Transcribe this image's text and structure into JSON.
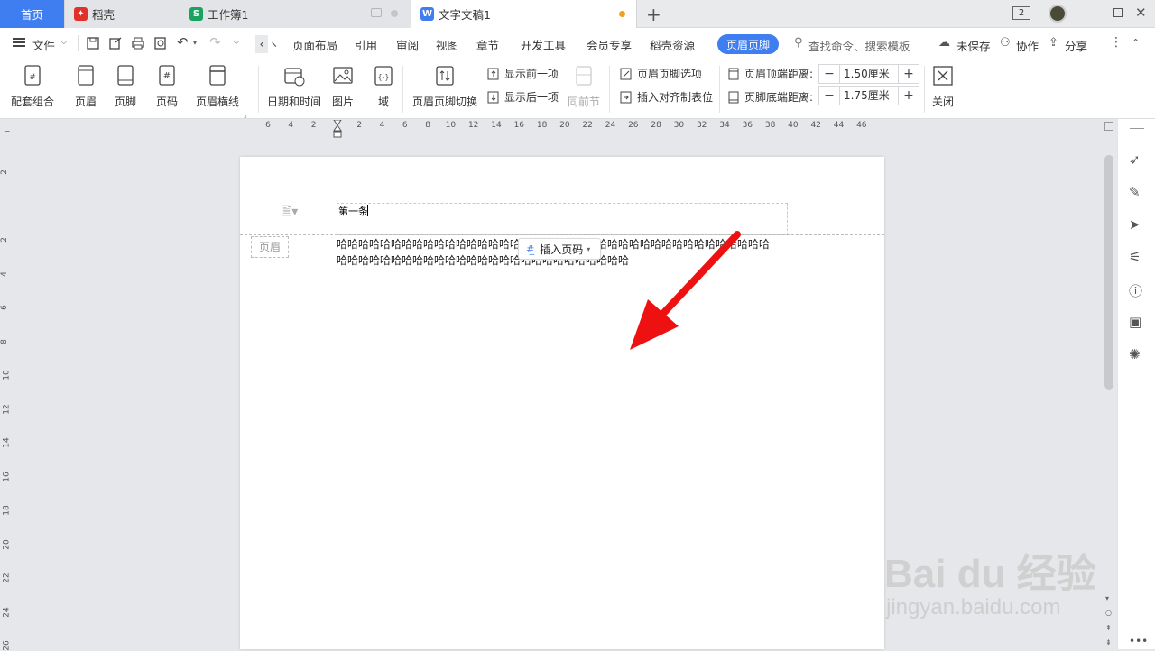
{
  "tabs": [
    {
      "label": "首页"
    },
    {
      "label": "稻壳"
    },
    {
      "label": "工作簿1"
    },
    {
      "label": "文字文稿1"
    }
  ],
  "window_badge": "2",
  "menu": {
    "file": "文件",
    "items": [
      "页面布局",
      "引用",
      "审阅",
      "视图",
      "章节",
      "开发工具",
      "会员专享",
      "稻壳资源"
    ],
    "active": "页眉页脚",
    "search": "查找命令、搜索模板",
    "unsaved": "未保存",
    "collab": "协作",
    "share": "分享"
  },
  "ribbon": {
    "set": "配套组合",
    "header": "页眉",
    "footer": "页脚",
    "pagenum": "页码",
    "headerline": "页眉横线",
    "datetime": "日期和时间",
    "picture": "图片",
    "field": "域",
    "switch": "页眉页脚切换",
    "showprev": "显示前一项",
    "shownext": "显示后一项",
    "samesection": "同前节",
    "options": "页眉页脚选项",
    "inserttab": "插入对齐制表位",
    "topdist_label": "页眉顶端距离:",
    "topdist_val": "1.50厘米",
    "botdist_label": "页脚底端距离:",
    "botdist_val": "1.75厘米",
    "close": "关闭"
  },
  "ruler_h": [
    "6",
    "4",
    "2",
    "",
    "2",
    "4",
    "6",
    "8",
    "10",
    "12",
    "14",
    "16",
    "18",
    "20",
    "22",
    "24",
    "26",
    "28",
    "30",
    "32",
    "34",
    "36",
    "38",
    "40",
    "42",
    "44",
    "46"
  ],
  "ruler_v": [
    "2",
    "",
    "2",
    "4",
    "6",
    "8",
    "10",
    "12",
    "14",
    "16",
    "18",
    "20",
    "22",
    "24",
    "26"
  ],
  "doc": {
    "header_text": "第一条",
    "header_tag": "页眉",
    "insert_pagenum": "插入页码",
    "body_line1": "哈哈哈哈哈哈哈哈哈哈哈哈哈哈哈哈哈哈哈哈哈哈哈哈哈哈哈哈哈哈哈哈哈哈哈哈哈哈哈哈",
    "body_line2": "哈哈哈哈哈哈哈哈哈哈哈哈哈哈哈哈哈哈哈哈哈哈哈哈哈哈哈"
  },
  "watermark": {
    "text": "Bai du 经验",
    "url": "jingyan.baidu.com"
  },
  "colors": {
    "accent": "#3f7ef0",
    "arrow": "#ee1111",
    "wps_red": "#e0322b",
    "sheet_green": "#1aa260"
  }
}
